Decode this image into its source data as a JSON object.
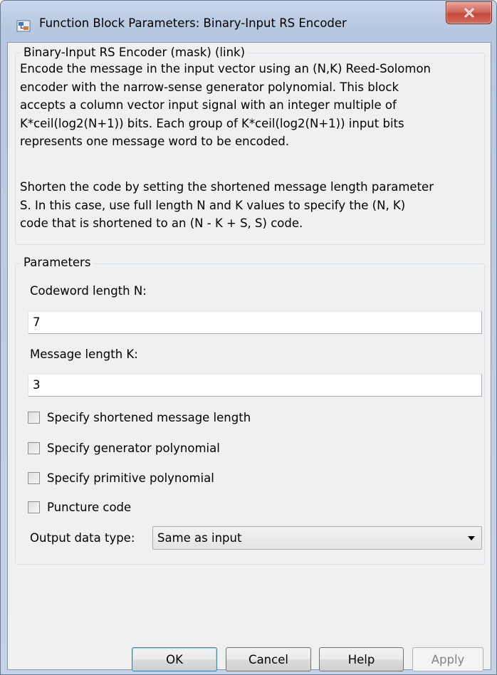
{
  "window": {
    "title": "Function Block Parameters: Binary-Input RS Encoder"
  },
  "description_group": {
    "legend": "Binary-Input RS Encoder (mask) (link)",
    "paragraph1": "Encode the message in the input vector using an (N,K) Reed-Solomon\nencoder with the narrow-sense generator polynomial.  This block\naccepts a column vector input signal with an integer multiple of\nK*ceil(log2(N+1)) bits.  Each group of K*ceil(log2(N+1)) input bits\nrepresents one message word to be encoded.",
    "paragraph2": "Shorten the code by setting the shortened message length parameter\nS. In this case, use full length N and K values to specify the (N, K)\ncode that is shortened to an (N - K + S, S) code."
  },
  "parameters": {
    "legend": "Parameters",
    "codeword_label": "Codeword length N:",
    "codeword_value": "7",
    "message_label": "Message length K:",
    "message_value": "3",
    "checkboxes": [
      {
        "label": "Specify shortened message length",
        "checked": false
      },
      {
        "label": "Specify generator polynomial",
        "checked": false
      },
      {
        "label": "Specify primitive polynomial",
        "checked": false
      },
      {
        "label": "Puncture code",
        "checked": false
      }
    ],
    "output_label": "Output data type:",
    "output_value": "Same as input"
  },
  "buttons": {
    "ok": "OK",
    "cancel": "Cancel",
    "help": "Help",
    "apply": "Apply"
  },
  "icons": {
    "app": "simulink-block-icon",
    "close": "close-icon"
  }
}
